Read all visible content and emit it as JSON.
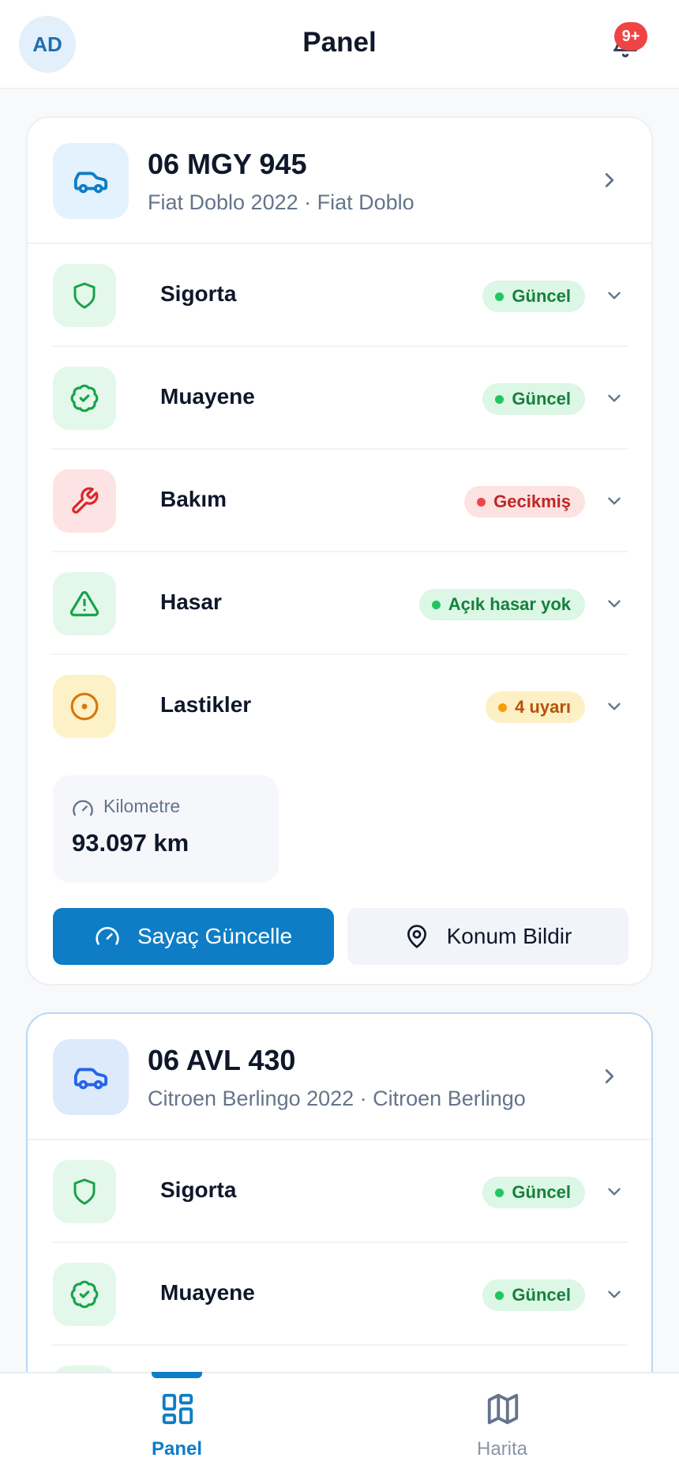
{
  "header": {
    "avatar_initials": "AD",
    "title": "Panel",
    "notification_badge": "9+"
  },
  "vehicles": [
    {
      "plate": "06 MGY 945",
      "model": "Fiat Doblo 2022 · Fiat Doblo",
      "rows": [
        {
          "label": "Sigorta",
          "status": "Güncel"
        },
        {
          "label": "Muayene",
          "status": "Güncel"
        },
        {
          "label": "Bakım",
          "status": "Gecikmiş"
        },
        {
          "label": "Hasar",
          "status": "Açık hasar yok"
        },
        {
          "label": "Lastikler",
          "status": "4 uyarı"
        }
      ],
      "odometer_label": "Kilometre",
      "odometer_value": "93.097 km",
      "primary_action": "Sayaç Güncelle",
      "secondary_action": "Konum Bildir"
    },
    {
      "plate": "06 AVL 430",
      "model": "Citroen Berlingo 2022 · Citroen Berlingo",
      "rows": [
        {
          "label": "Sigorta",
          "status": "Güncel"
        },
        {
          "label": "Muayene",
          "status": "Güncel"
        }
      ]
    }
  ],
  "bottom_nav": {
    "items": [
      {
        "label": "Panel",
        "icon": "grid-icon",
        "active": true
      },
      {
        "label": "Harita",
        "icon": "map-icon",
        "active": false
      }
    ]
  },
  "colors": {
    "primary": "#0e7dc6",
    "ok": "#16803d",
    "overdue": "#c02626",
    "warning": "#b45309"
  }
}
